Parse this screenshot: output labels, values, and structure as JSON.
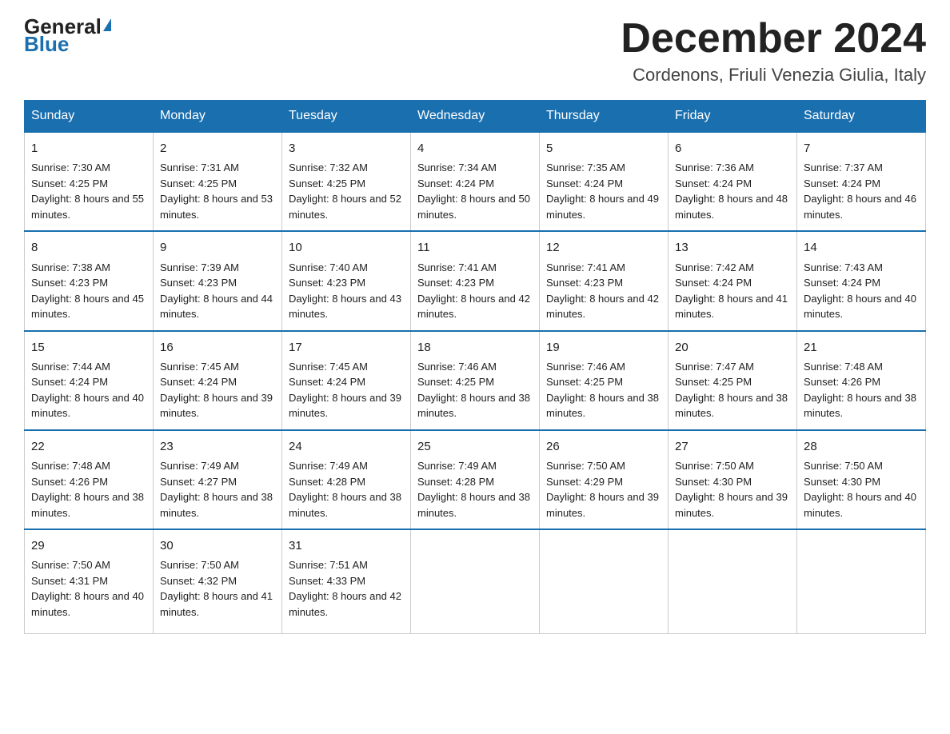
{
  "header": {
    "logo_general": "General",
    "logo_blue": "Blue",
    "month_title": "December 2024",
    "subtitle": "Cordenons, Friuli Venezia Giulia, Italy"
  },
  "days_of_week": [
    "Sunday",
    "Monday",
    "Tuesday",
    "Wednesday",
    "Thursday",
    "Friday",
    "Saturday"
  ],
  "weeks": [
    [
      {
        "day": "1",
        "sunrise": "7:30 AM",
        "sunset": "4:25 PM",
        "daylight": "8 hours and 55 minutes."
      },
      {
        "day": "2",
        "sunrise": "7:31 AM",
        "sunset": "4:25 PM",
        "daylight": "8 hours and 53 minutes."
      },
      {
        "day": "3",
        "sunrise": "7:32 AM",
        "sunset": "4:25 PM",
        "daylight": "8 hours and 52 minutes."
      },
      {
        "day": "4",
        "sunrise": "7:34 AM",
        "sunset": "4:24 PM",
        "daylight": "8 hours and 50 minutes."
      },
      {
        "day": "5",
        "sunrise": "7:35 AM",
        "sunset": "4:24 PM",
        "daylight": "8 hours and 49 minutes."
      },
      {
        "day": "6",
        "sunrise": "7:36 AM",
        "sunset": "4:24 PM",
        "daylight": "8 hours and 48 minutes."
      },
      {
        "day": "7",
        "sunrise": "7:37 AM",
        "sunset": "4:24 PM",
        "daylight": "8 hours and 46 minutes."
      }
    ],
    [
      {
        "day": "8",
        "sunrise": "7:38 AM",
        "sunset": "4:23 PM",
        "daylight": "8 hours and 45 minutes."
      },
      {
        "day": "9",
        "sunrise": "7:39 AM",
        "sunset": "4:23 PM",
        "daylight": "8 hours and 44 minutes."
      },
      {
        "day": "10",
        "sunrise": "7:40 AM",
        "sunset": "4:23 PM",
        "daylight": "8 hours and 43 minutes."
      },
      {
        "day": "11",
        "sunrise": "7:41 AM",
        "sunset": "4:23 PM",
        "daylight": "8 hours and 42 minutes."
      },
      {
        "day": "12",
        "sunrise": "7:41 AM",
        "sunset": "4:23 PM",
        "daylight": "8 hours and 42 minutes."
      },
      {
        "day": "13",
        "sunrise": "7:42 AM",
        "sunset": "4:24 PM",
        "daylight": "8 hours and 41 minutes."
      },
      {
        "day": "14",
        "sunrise": "7:43 AM",
        "sunset": "4:24 PM",
        "daylight": "8 hours and 40 minutes."
      }
    ],
    [
      {
        "day": "15",
        "sunrise": "7:44 AM",
        "sunset": "4:24 PM",
        "daylight": "8 hours and 40 minutes."
      },
      {
        "day": "16",
        "sunrise": "7:45 AM",
        "sunset": "4:24 PM",
        "daylight": "8 hours and 39 minutes."
      },
      {
        "day": "17",
        "sunrise": "7:45 AM",
        "sunset": "4:24 PM",
        "daylight": "8 hours and 39 minutes."
      },
      {
        "day": "18",
        "sunrise": "7:46 AM",
        "sunset": "4:25 PM",
        "daylight": "8 hours and 38 minutes."
      },
      {
        "day": "19",
        "sunrise": "7:46 AM",
        "sunset": "4:25 PM",
        "daylight": "8 hours and 38 minutes."
      },
      {
        "day": "20",
        "sunrise": "7:47 AM",
        "sunset": "4:25 PM",
        "daylight": "8 hours and 38 minutes."
      },
      {
        "day": "21",
        "sunrise": "7:48 AM",
        "sunset": "4:26 PM",
        "daylight": "8 hours and 38 minutes."
      }
    ],
    [
      {
        "day": "22",
        "sunrise": "7:48 AM",
        "sunset": "4:26 PM",
        "daylight": "8 hours and 38 minutes."
      },
      {
        "day": "23",
        "sunrise": "7:49 AM",
        "sunset": "4:27 PM",
        "daylight": "8 hours and 38 minutes."
      },
      {
        "day": "24",
        "sunrise": "7:49 AM",
        "sunset": "4:28 PM",
        "daylight": "8 hours and 38 minutes."
      },
      {
        "day": "25",
        "sunrise": "7:49 AM",
        "sunset": "4:28 PM",
        "daylight": "8 hours and 38 minutes."
      },
      {
        "day": "26",
        "sunrise": "7:50 AM",
        "sunset": "4:29 PM",
        "daylight": "8 hours and 39 minutes."
      },
      {
        "day": "27",
        "sunrise": "7:50 AM",
        "sunset": "4:30 PM",
        "daylight": "8 hours and 39 minutes."
      },
      {
        "day": "28",
        "sunrise": "7:50 AM",
        "sunset": "4:30 PM",
        "daylight": "8 hours and 40 minutes."
      }
    ],
    [
      {
        "day": "29",
        "sunrise": "7:50 AM",
        "sunset": "4:31 PM",
        "daylight": "8 hours and 40 minutes."
      },
      {
        "day": "30",
        "sunrise": "7:50 AM",
        "sunset": "4:32 PM",
        "daylight": "8 hours and 41 minutes."
      },
      {
        "day": "31",
        "sunrise": "7:51 AM",
        "sunset": "4:33 PM",
        "daylight": "8 hours and 42 minutes."
      },
      null,
      null,
      null,
      null
    ]
  ]
}
